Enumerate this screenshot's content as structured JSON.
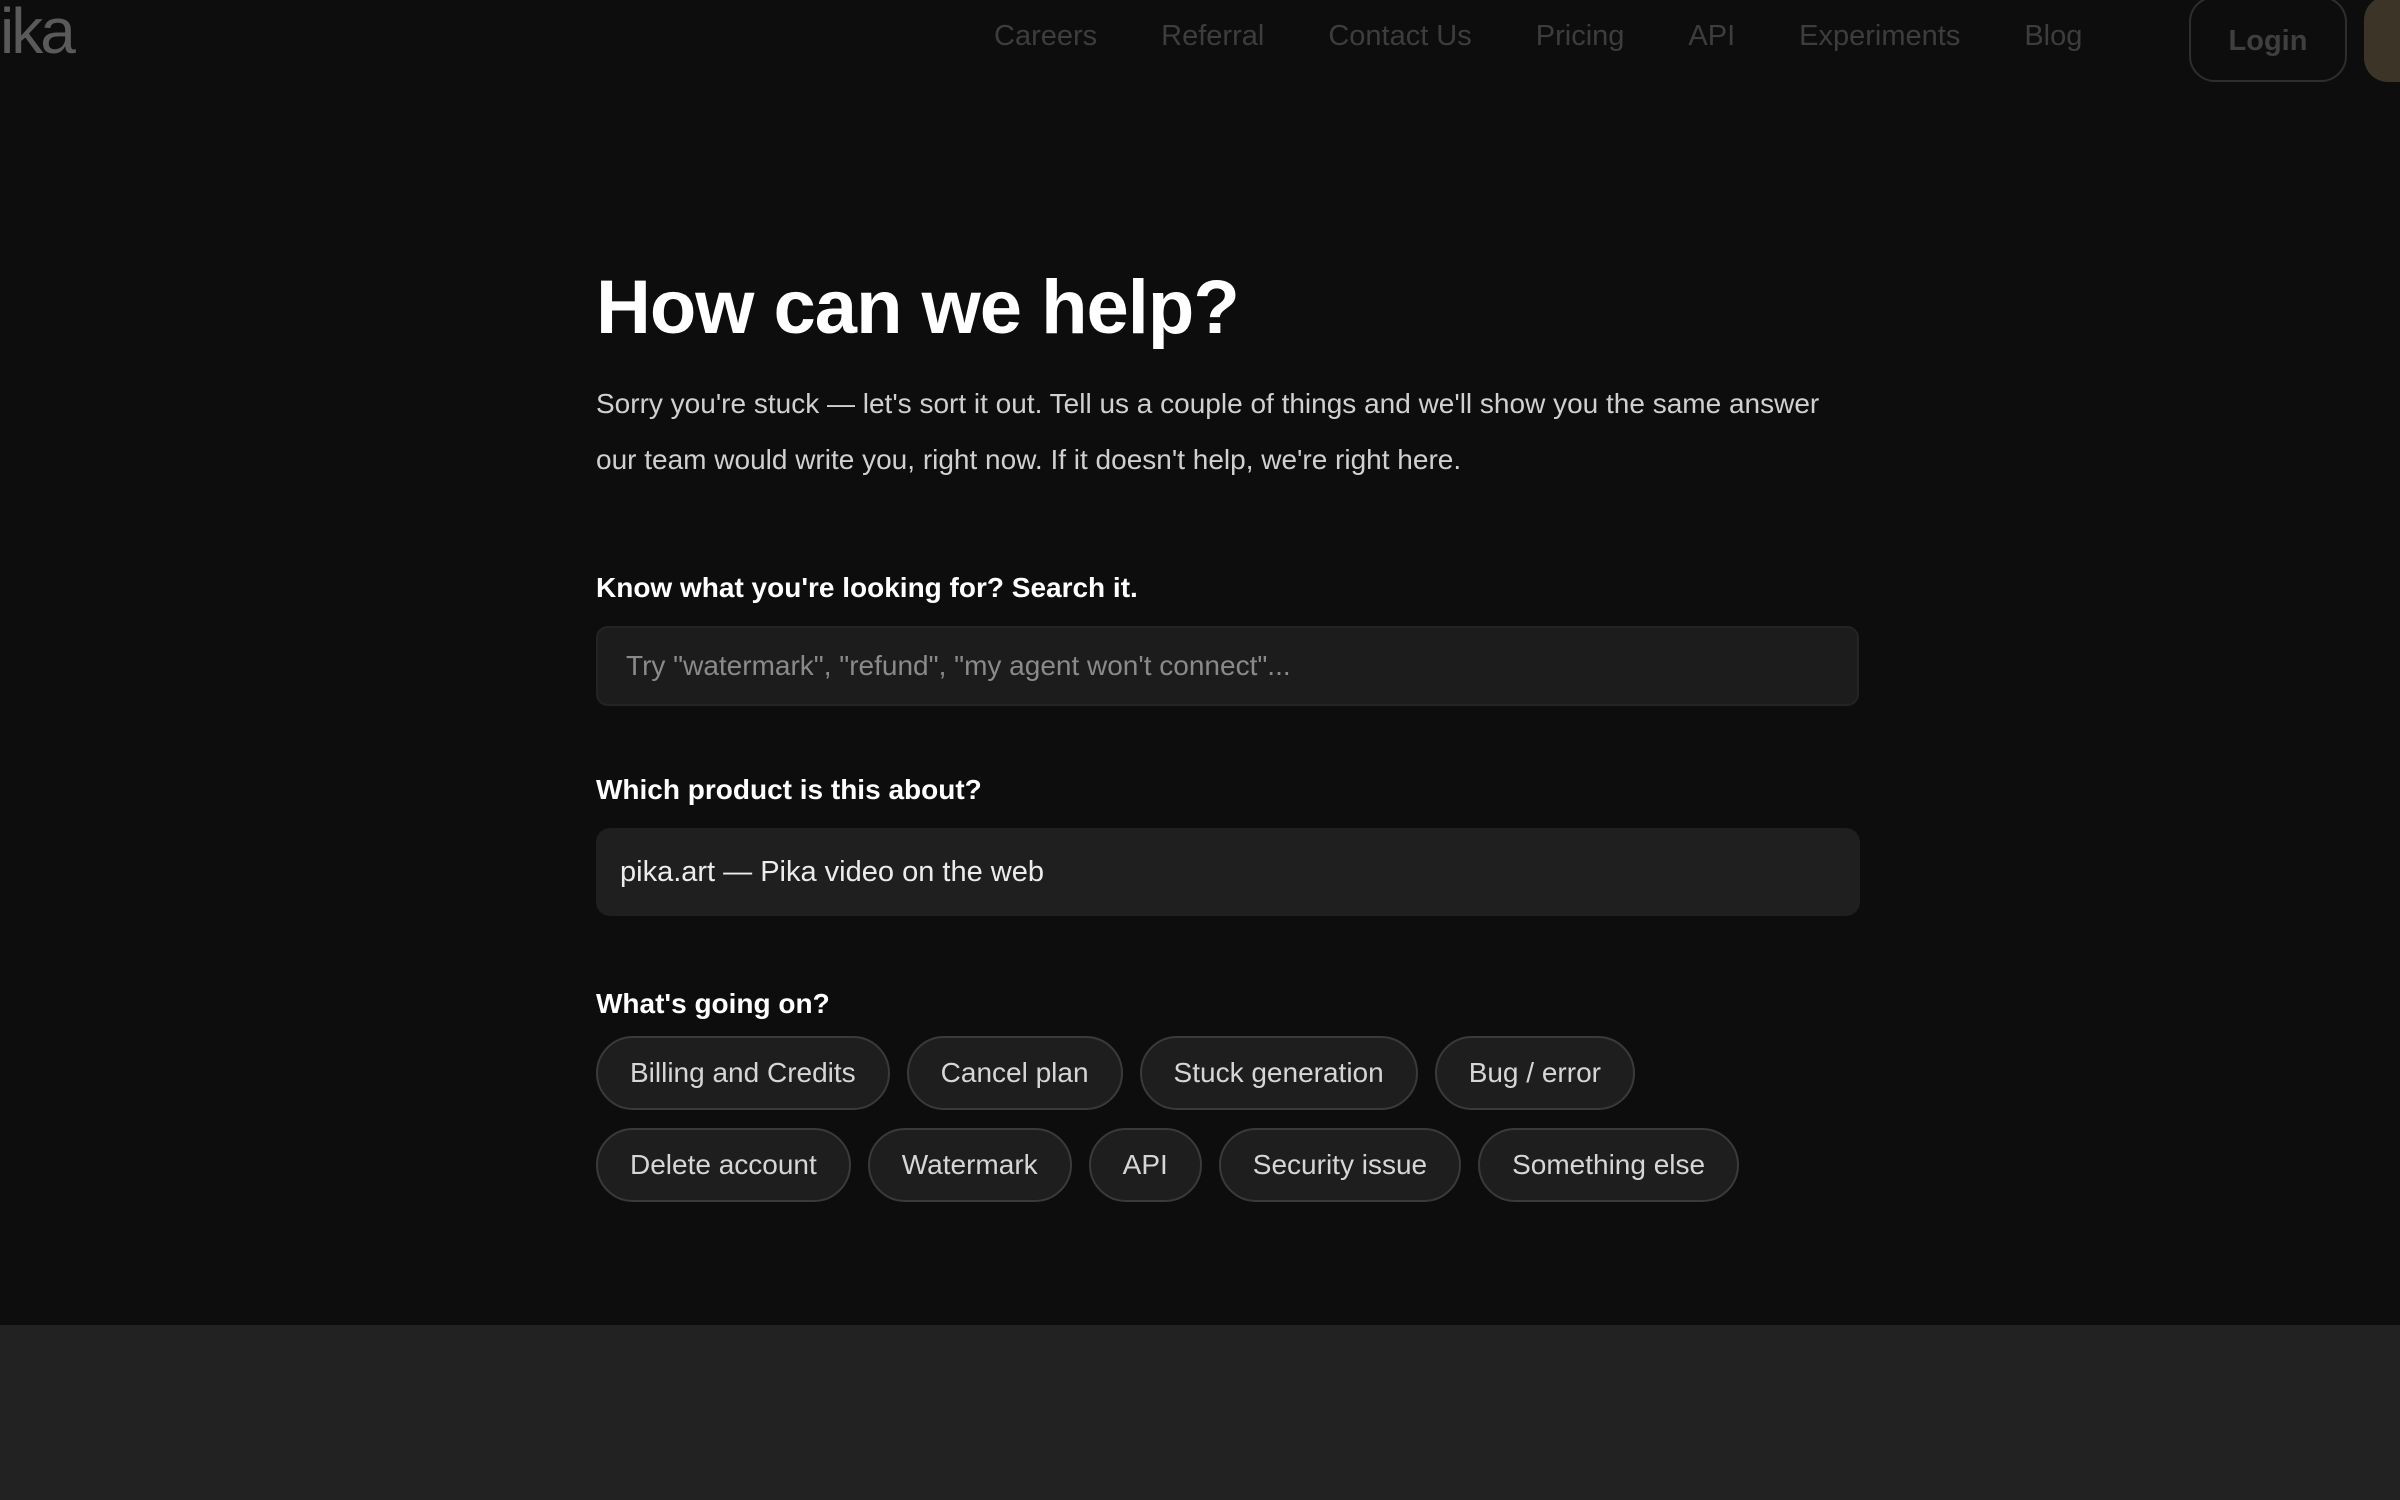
{
  "nav": {
    "logo": "ika",
    "links": [
      "Careers",
      "Referral",
      "Contact Us",
      "Pricing",
      "API",
      "Experiments",
      "Blog"
    ],
    "login_label": "Login"
  },
  "main": {
    "title": "How can we help?",
    "subtitle": "Sorry you're stuck — let's sort it out. Tell us a couple of things and we'll show you the same answer our team would write you, right now. If it doesn't help, we're right here.",
    "search": {
      "label": "Know what you're looking for? Search it.",
      "placeholder": "Try \"watermark\", \"refund\", \"my agent won't connect\"...",
      "value": ""
    },
    "product": {
      "label": "Which product is this about?",
      "selected": "pika.art — Pika video on the web"
    },
    "issue": {
      "label": "What's going on?",
      "options": [
        "Billing and Credits",
        "Cancel plan",
        "Stuck generation",
        "Bug / error",
        "Delete account",
        "Watermark",
        "API",
        "Security issue",
        "Something else"
      ]
    }
  },
  "colors": {
    "background": "#0d0d0d",
    "input_bg": "#1c1c1c",
    "chip_border": "#3a3a3a",
    "footer_bg": "#222222",
    "signup_accent": "#3c3527"
  }
}
